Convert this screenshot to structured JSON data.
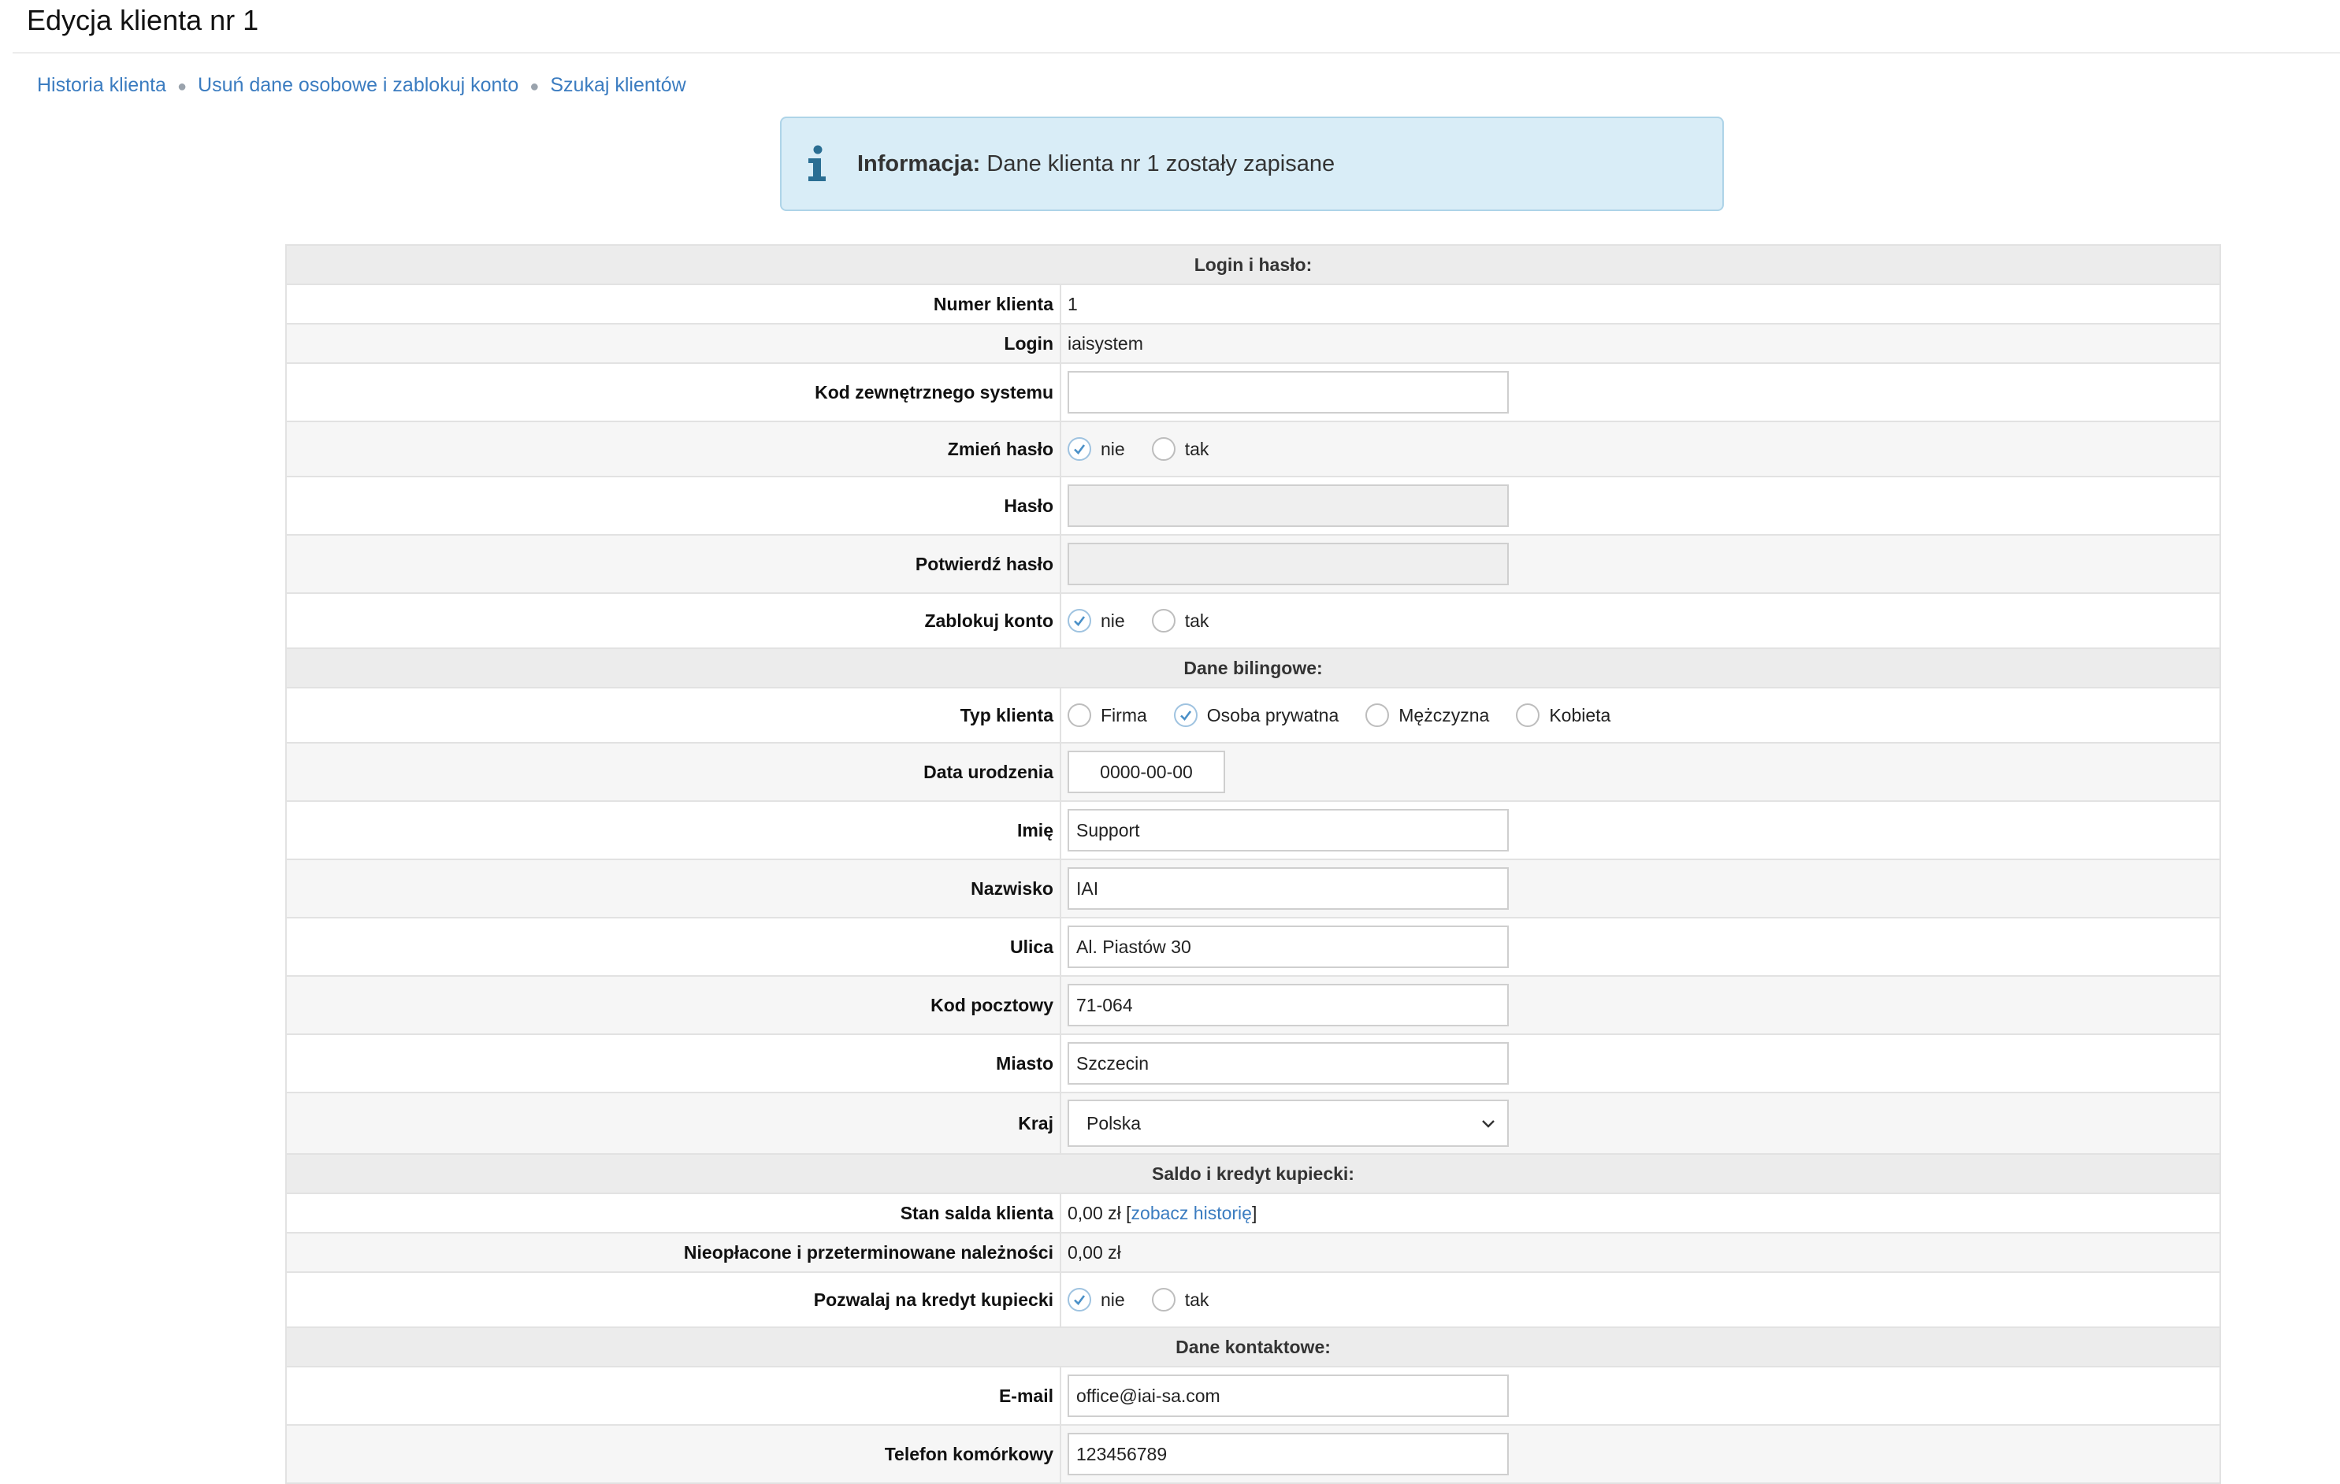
{
  "page": {
    "title": "Edycja klienta nr 1"
  },
  "breadcrumb": {
    "items": [
      "Historia klienta",
      "Usuń dane osobowe i zablokuj konto",
      "Szukaj klientów"
    ]
  },
  "info": {
    "label": "Informacja:",
    "message": "Dane klienta nr 1 zostały zapisane",
    "icon": "info-icon",
    "color": "#2a6e93"
  },
  "sections": {
    "login": "Login i hasło:",
    "billing": "Dane bilingowe:",
    "balance": "Saldo i kredyt kupiecki:",
    "contact": "Dane kontaktowe:"
  },
  "login": {
    "client_number_label": "Numer klienta",
    "client_number": "1",
    "login_label": "Login",
    "login": "iaisystem",
    "ext_code_label": "Kod zewnętrznego systemu",
    "ext_code": "",
    "change_pass_label": "Zmień hasło",
    "password_label": "Hasło",
    "confirm_label": "Potwierdź hasło",
    "block_label": "Zablokuj konto"
  },
  "options": {
    "no": "nie",
    "yes": "tak"
  },
  "billing": {
    "type_label": "Typ klienta",
    "types": [
      "Firma",
      "Osoba prywatna",
      "Mężczyzna",
      "Kobieta"
    ],
    "selected_type": "Osoba prywatna",
    "birth_label": "Data urodzenia",
    "birth": "0000-00-00",
    "first_name_label": "Imię",
    "first_name": "Support",
    "last_name_label": "Nazwisko",
    "last_name": "IAI",
    "street_label": "Ulica",
    "street": "Al. Piastów 30",
    "zip_label": "Kod pocztowy",
    "zip": "71-064",
    "city_label": "Miasto",
    "city": "Szczecin",
    "country_label": "Kraj",
    "country": "Polska"
  },
  "balance": {
    "balance_label": "Stan salda klienta",
    "balance": "0,00 zł",
    "history_link": "zobacz historię",
    "overdue_label": "Nieopłacone i przeterminowane należności",
    "overdue": "0,00 zł",
    "credit_label": "Pozwalaj na kredyt kupiecki"
  },
  "contact": {
    "email_label": "E-mail",
    "email": "office@iai-sa.com",
    "mobile_label": "Telefon komórkowy",
    "mobile": "123456789"
  }
}
